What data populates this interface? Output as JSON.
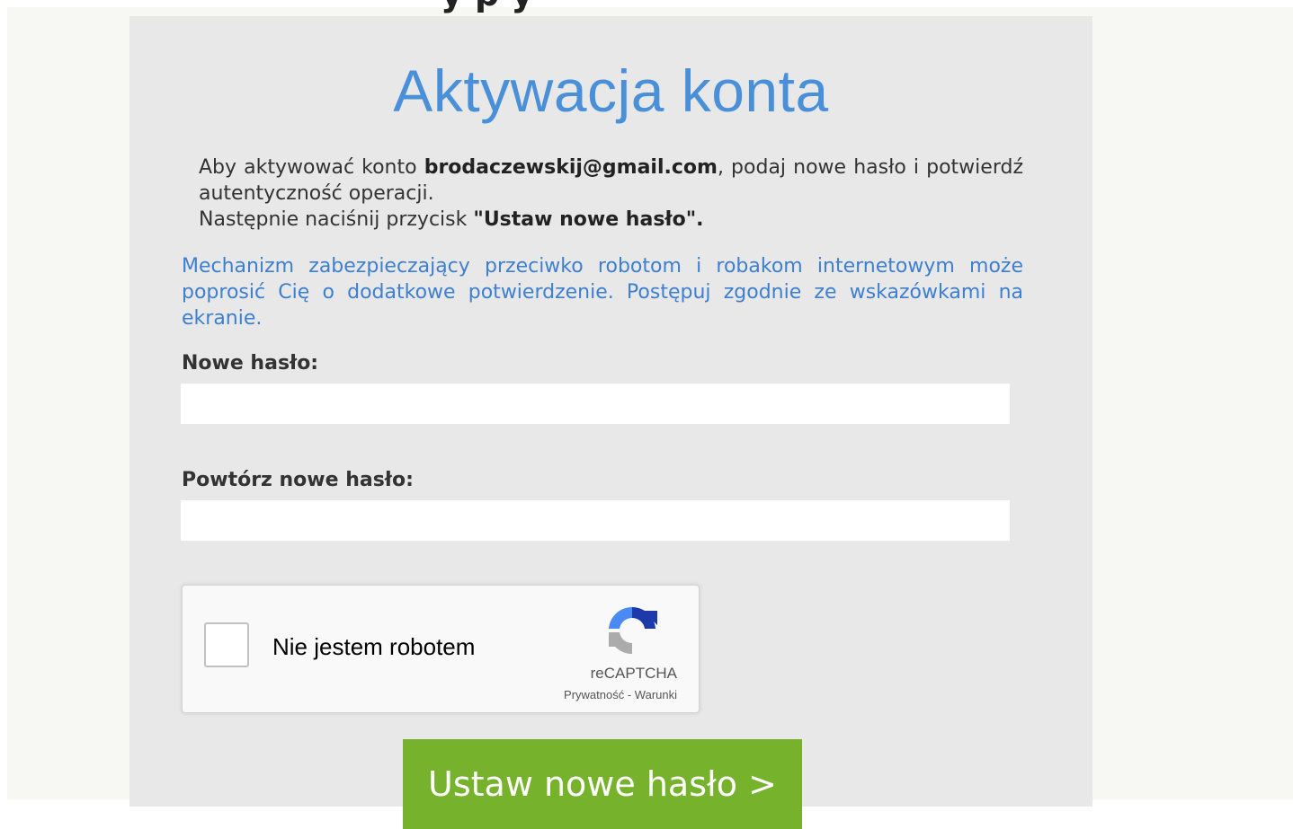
{
  "header": {
    "cut_title": "y p y"
  },
  "page": {
    "title": "Aktywacja konta"
  },
  "intro": {
    "prefix": "Aby aktywować konto ",
    "email": "brodaczewskij@gmail.com",
    "suffix": ", podaj nowe hasło i potwierdź autentyczność operacji.",
    "line2_prefix": "Następnie naciśnij przycisk ",
    "line2_button_ref": "\"Ustaw nowe hasło\"."
  },
  "notice": {
    "text": "Mechanizm zabezpieczający przeciwko robotom i robakom internetowym może poprosić Cię o dodatkowe potwierdzenie. Postępuj zgodnie ze wskazówkami na ekranie."
  },
  "form": {
    "new_password_label": "Nowe hasło:",
    "new_password_value": "",
    "repeat_password_label": "Powtórz nowe hasło:",
    "repeat_password_value": ""
  },
  "captcha": {
    "label": "Nie jestem robotem",
    "brand": "reCAPTCHA",
    "privacy": "Prywatność",
    "separator": " - ",
    "terms": "Warunki",
    "icon": "recaptcha-logo"
  },
  "submit": {
    "label": "Ustaw nowe hasło >"
  },
  "colors": {
    "title": "#4a90d9",
    "notice": "#3d7fd0",
    "panel": "#e8e8e8",
    "button": "#76b22c"
  }
}
